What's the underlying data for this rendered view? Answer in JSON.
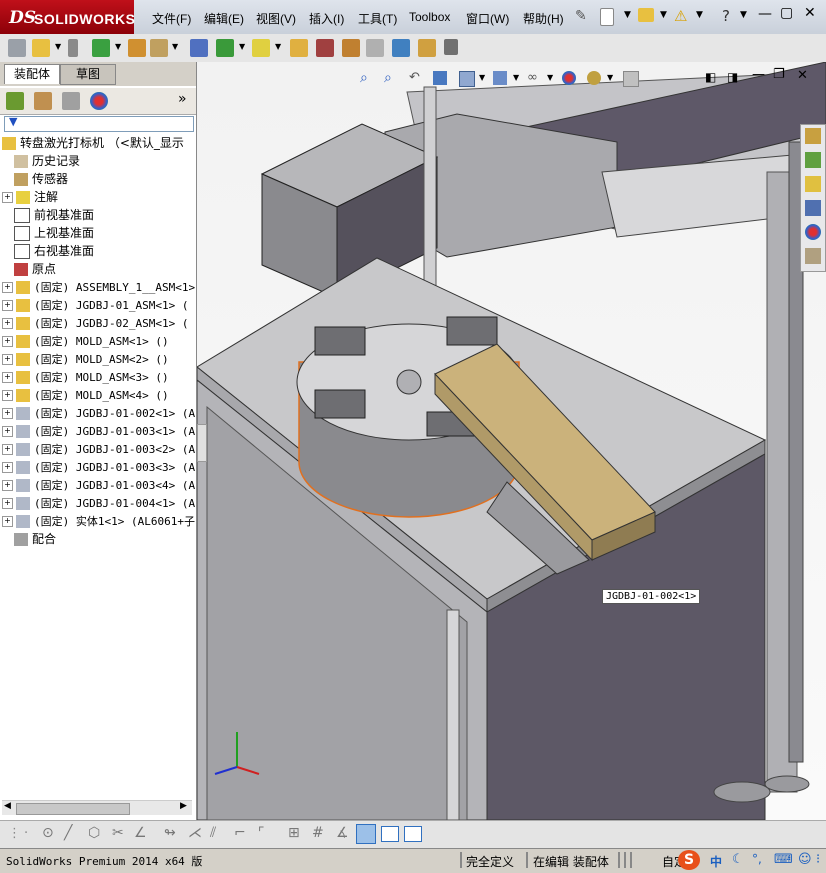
{
  "app": {
    "brand_ds": "DS",
    "brand_name": "SOLIDWORKS"
  },
  "menu": [
    "文件(F)",
    "编辑(E)",
    "视图(V)",
    "插入(I)",
    "工具(T)",
    "Toolbox",
    "窗口(W)",
    "帮助(H)"
  ],
  "tabs": {
    "assembly": "装配体",
    "sketch": "草图"
  },
  "tree": {
    "root": "转盘激光打标机 （<默认_显示",
    "items": [
      {
        "label": "历史记录",
        "icon": "history-icon",
        "expand": false,
        "mono": false
      },
      {
        "label": "传感器",
        "icon": "sensor-icon",
        "expand": false,
        "mono": false
      },
      {
        "label": "注解",
        "icon": "annotation-icon",
        "expand": true,
        "mono": false
      },
      {
        "label": "前视基准面",
        "icon": "plane-icon",
        "expand": false,
        "mono": false
      },
      {
        "label": "上视基准面",
        "icon": "plane-icon",
        "expand": false,
        "mono": false
      },
      {
        "label": "右视基准面",
        "icon": "plane-icon",
        "expand": false,
        "mono": false
      },
      {
        "label": "原点",
        "icon": "origin-icon",
        "expand": false,
        "mono": false
      },
      {
        "label": "(固定) ASSEMBLY_1__ASM<1>",
        "icon": "assembly-icon",
        "expand": true,
        "mono": true
      },
      {
        "label": "(固定) JGDBJ-01_ASM<1> (",
        "icon": "assembly-icon",
        "expand": true,
        "mono": true
      },
      {
        "label": "(固定) JGDBJ-02_ASM<1> (",
        "icon": "assembly-icon",
        "expand": true,
        "mono": true
      },
      {
        "label": "(固定) MOLD_ASM<1> ()",
        "icon": "assembly-icon",
        "expand": true,
        "mono": true
      },
      {
        "label": "(固定) MOLD_ASM<2> ()",
        "icon": "assembly-icon",
        "expand": true,
        "mono": true
      },
      {
        "label": "(固定) MOLD_ASM<3> ()",
        "icon": "assembly-icon",
        "expand": true,
        "mono": true
      },
      {
        "label": "(固定) MOLD_ASM<4> ()",
        "icon": "assembly-icon",
        "expand": true,
        "mono": true
      },
      {
        "label": "(固定) JGDBJ-01-002<1> (A",
        "icon": "part-icon",
        "expand": true,
        "mono": true
      },
      {
        "label": "(固定) JGDBJ-01-003<1> (A",
        "icon": "part-icon",
        "expand": true,
        "mono": true
      },
      {
        "label": "(固定) JGDBJ-01-003<2> (A",
        "icon": "part-icon",
        "expand": true,
        "mono": true
      },
      {
        "label": "(固定) JGDBJ-01-003<3> (A",
        "icon": "part-icon",
        "expand": true,
        "mono": true
      },
      {
        "label": "(固定) JGDBJ-01-003<4> (A",
        "icon": "part-icon",
        "expand": true,
        "mono": true
      },
      {
        "label": "(固定) JGDBJ-01-004<1> (A",
        "icon": "part-icon",
        "expand": true,
        "mono": true
      },
      {
        "label": "(固定) 实体1<1> (AL6061+子",
        "icon": "part-icon",
        "expand": true,
        "mono": true
      },
      {
        "label": "配合",
        "icon": "mates-icon",
        "expand": false,
        "mono": false
      }
    ]
  },
  "viewport": {
    "callout": "JGDBJ-01-002<1>"
  },
  "status": {
    "version": "SolidWorks Premium 2014 x64 版",
    "defined": "完全定义",
    "editing": "在编辑 装配体",
    "custom": "自定"
  },
  "tray": {
    "ime_cn": "中"
  },
  "colors": {
    "brand_red": "#b0101a",
    "part_tan": "#c9b07a",
    "frame_gray": "#8a8a90",
    "table_top": "#c8c8ca",
    "cabinet": "#5d5866",
    "selection": "#e07020"
  }
}
